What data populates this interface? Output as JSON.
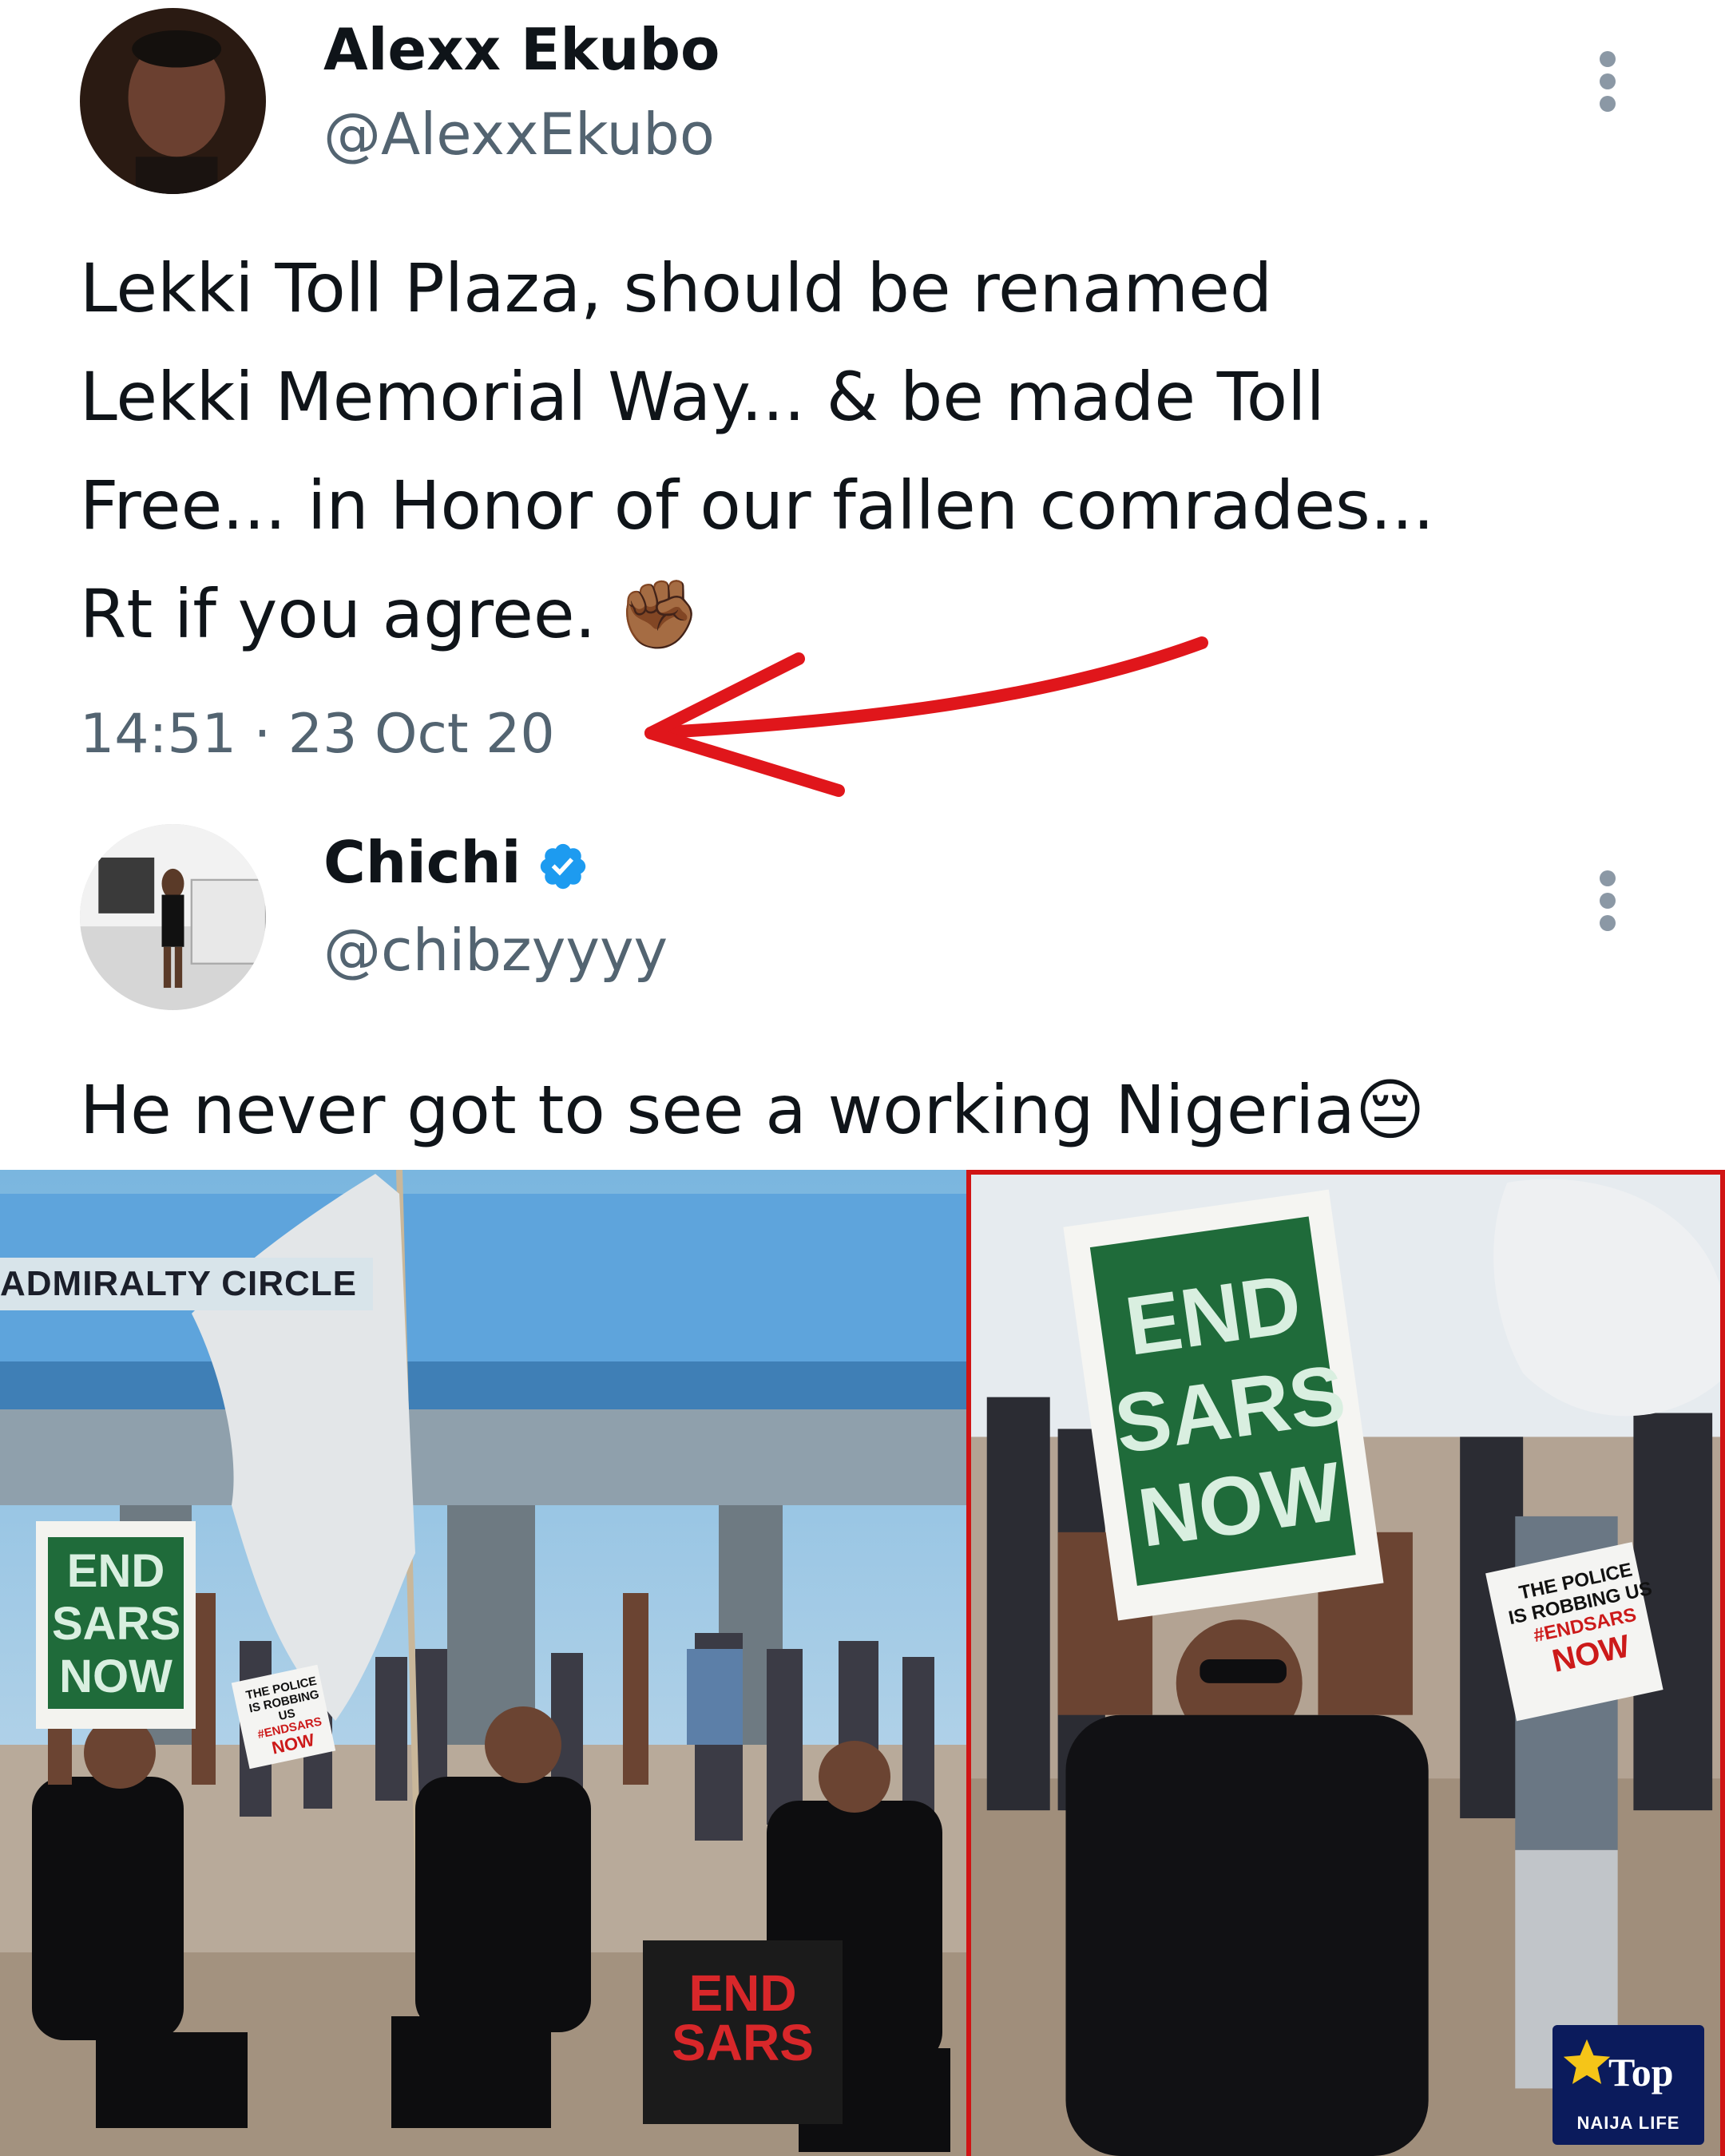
{
  "tweet1": {
    "name": "Alexx Ekubo",
    "handle": "@AlexxEkubo",
    "text": "Lekki Toll Plaza, should be renamed\nLekki Memorial Way... & be made Toll\nFree... in Honor of our fallen comrades...\nRt if you agree. ✊🏾",
    "timestamp": "14:51 · 23 Oct 20"
  },
  "tweet2": {
    "name": "Chichi",
    "handle": "@chibzyyyy",
    "text": "He never got to see a working Nigeria😔"
  },
  "photo_left": {
    "banner": "ADMIRALTY CIRCLE",
    "sign_main": [
      "END",
      "SARS",
      "NOW"
    ],
    "sign_small": [
      "THE POLICE",
      "IS ROBBING US",
      "#ENDSARS",
      "NOW"
    ],
    "sign_black": [
      "END",
      "SARS"
    ]
  },
  "photo_right": {
    "sign_main": [
      "END",
      "SARS",
      "NOW"
    ],
    "sign_small": [
      "THE POLICE",
      "IS ROBBING US",
      "#ENDSARS",
      "NOW"
    ]
  },
  "watermark": {
    "logo": "Top",
    "label": "NAIJA LIFE"
  },
  "colors": {
    "annotation_red": "#e0161b",
    "verified_blue": "#1d9bf0",
    "photo_border": "#d01414"
  }
}
